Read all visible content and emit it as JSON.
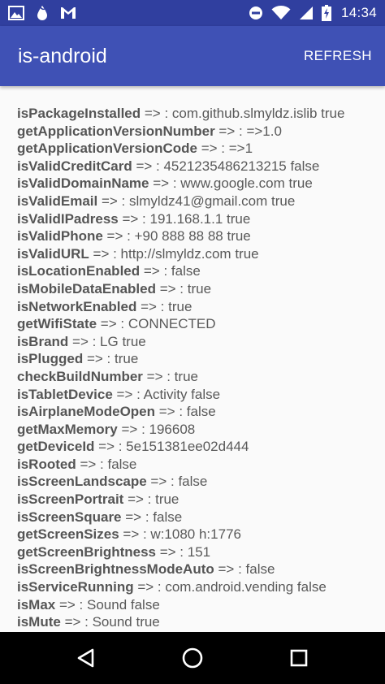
{
  "status_bar": {
    "time": "14:34",
    "left_icons": [
      "image-icon",
      "water-drop-icon",
      "gmail-icon"
    ],
    "right_icons": [
      "do-not-disturb-icon",
      "wifi-icon",
      "signal-icon",
      "battery-charging-icon"
    ]
  },
  "app_bar": {
    "title": "is-android",
    "refresh_label": "REFRESH",
    "color": "#3f51b5",
    "status_color": "#303f9f"
  },
  "results": [
    {
      "method": "isPackageInstalled",
      "value": " => : com.github.slmyldz.islib true"
    },
    {
      "method": "getApplicationVersionNumber",
      "value": " => : =>1.0"
    },
    {
      "method": "getApplicationVersionCode",
      "value": " => : =>1"
    },
    {
      "method": "isValidCreditCard",
      "value": " => : 4521235486213215 false"
    },
    {
      "method": "isValidDomainName",
      "value": " => : www.google.com true"
    },
    {
      "method": "isValidEmail",
      "value": " => : slmyldz41@gmail.com true"
    },
    {
      "method": "isValidIPadress",
      "value": " => : 191.168.1.1 true"
    },
    {
      "method": "isValidPhone",
      "value": " => : +90 888 88 88 true"
    },
    {
      "method": "isValidURL",
      "value": " => : http://slmyldz.com true"
    },
    {
      "method": "isLocationEnabled",
      "value": " => : false"
    },
    {
      "method": "isMobileDataEnabled",
      "value": " => : true"
    },
    {
      "method": "isNetworkEnabled",
      "value": " => : true"
    },
    {
      "method": "getWifiState",
      "value": " => : CONNECTED"
    },
    {
      "method": "isBrand",
      "value": " => : LG true"
    },
    {
      "method": "isPlugged",
      "value": " => : true"
    },
    {
      "method": "checkBuildNumber",
      "value": " => : true"
    },
    {
      "method": "isTabletDevice",
      "value": " => : Activity false"
    },
    {
      "method": "isAirplaneModeOpen",
      "value": " => : false"
    },
    {
      "method": "getMaxMemory",
      "value": " => : 196608"
    },
    {
      "method": "getDeviceId",
      "value": " => : 5e151381ee02d444"
    },
    {
      "method": "isRooted",
      "value": " => : false"
    },
    {
      "method": "isScreenLandscape",
      "value": " => : false"
    },
    {
      "method": "isScreenPortrait",
      "value": " => : true"
    },
    {
      "method": "isScreenSquare",
      "value": " => : false"
    },
    {
      "method": "getScreenSizes",
      "value": " => : w:1080 h:1776"
    },
    {
      "method": "getScreenBrightness",
      "value": " => : 151"
    },
    {
      "method": "isScreenBrightnessModeAuto",
      "value": " => : false"
    },
    {
      "method": "isServiceRunning",
      "value": " => : com.android.vending false"
    },
    {
      "method": "isMax",
      "value": " => : Sound false"
    },
    {
      "method": "isMute",
      "value": " => : Sound true"
    }
  ],
  "nav_bar": {
    "icons": [
      "back-icon",
      "home-icon",
      "recents-icon"
    ]
  }
}
